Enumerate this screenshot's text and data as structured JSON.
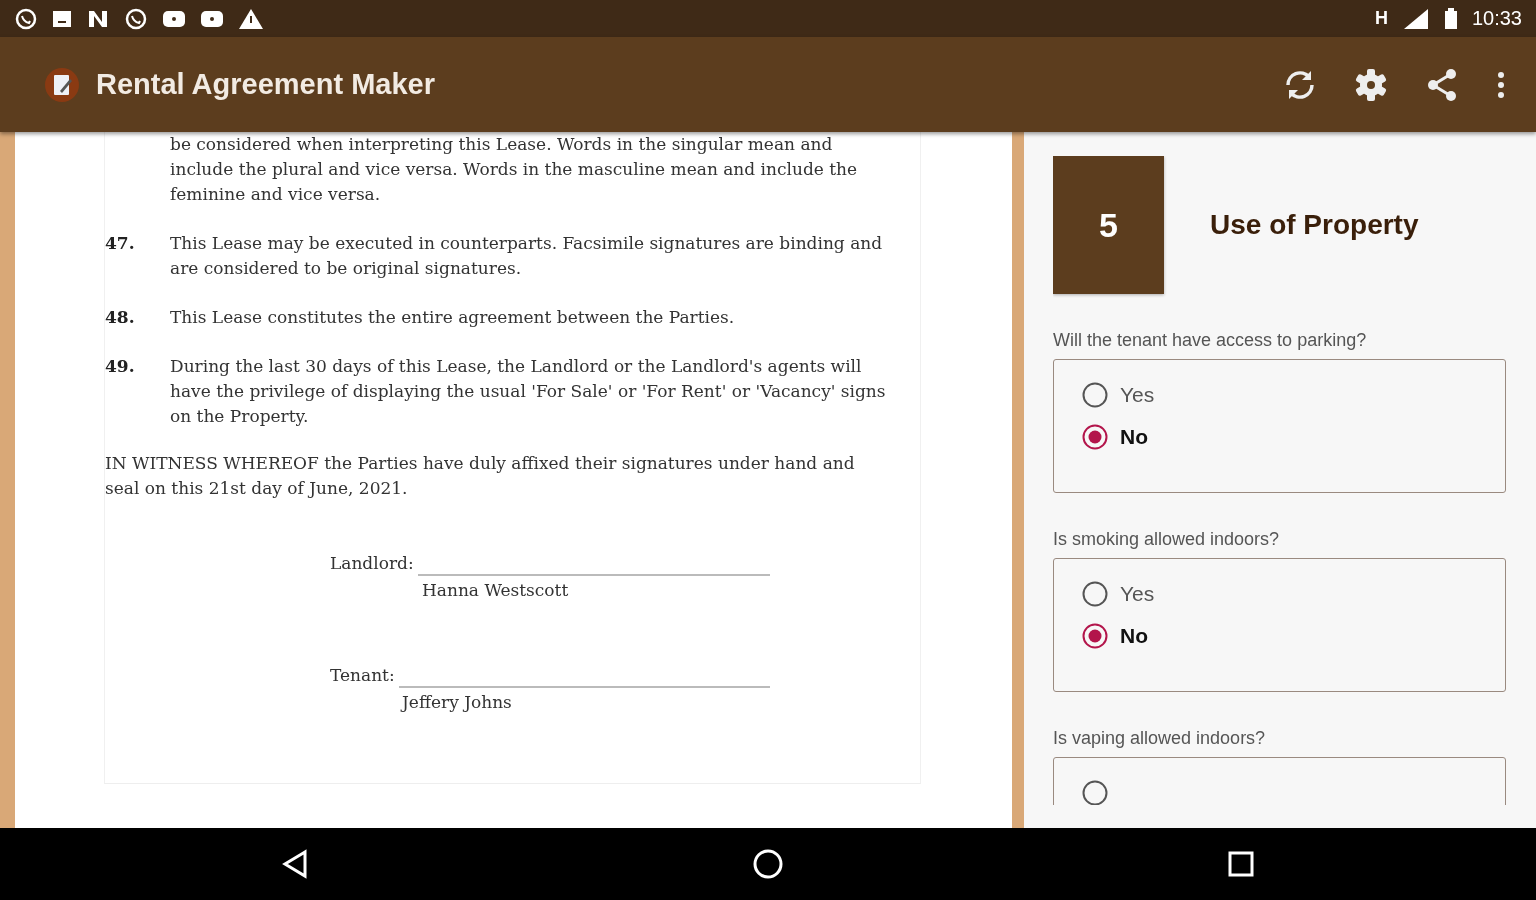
{
  "status_bar": {
    "network": "H",
    "time": "10:33"
  },
  "app_bar": {
    "title": "Rental Agreement Maker"
  },
  "document": {
    "continued_text": "be considered when interpreting this Lease. Words in the singular mean and include the plural and vice versa. Words in the masculine mean and include the feminine and vice versa.",
    "clauses": [
      {
        "number": "47.",
        "text": "This Lease may be executed in counterparts. Facsimile signatures are binding and are considered to be original signatures."
      },
      {
        "number": "48.",
        "text": "This Lease constitutes the entire agreement between the Parties."
      },
      {
        "number": "49.",
        "text": "During the last 30 days of this Lease, the Landlord or the Landlord's agents will have the privilege of displaying the usual 'For Sale' or 'For Rent' or 'Vacancy' signs on the Property."
      }
    ],
    "witness": "IN WITNESS WHEREOF the Parties have duly affixed their signatures under hand and seal on this 21st day of June, 2021.",
    "signatures": [
      {
        "role": "Landlord:",
        "name": "Hanna Westscott"
      },
      {
        "role": "Tenant:",
        "name": "Jeffery Johns"
      }
    ]
  },
  "step": {
    "number": "5",
    "title": "Use of Property"
  },
  "questions": [
    {
      "label": "Will the tenant have access to parking?",
      "options": [
        {
          "label": "Yes",
          "selected": false
        },
        {
          "label": "No",
          "selected": true
        }
      ]
    },
    {
      "label": "Is smoking allowed indoors?",
      "options": [
        {
          "label": "Yes",
          "selected": false
        },
        {
          "label": "No",
          "selected": true
        }
      ]
    },
    {
      "label": "Is vaping allowed indoors?"
    }
  ]
}
